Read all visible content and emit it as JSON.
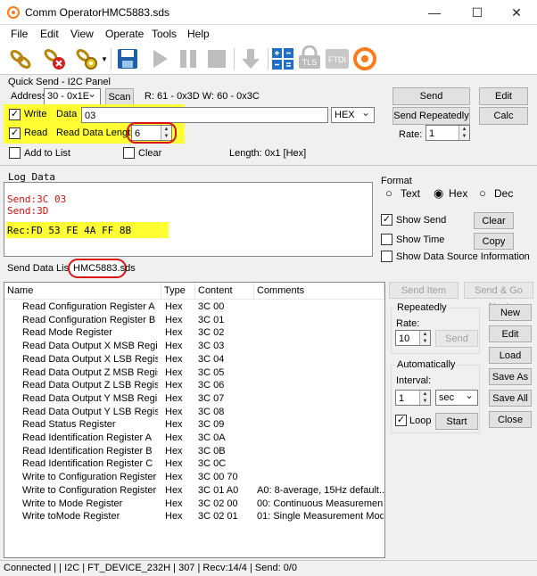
{
  "window": {
    "app_name": "Comm Operator",
    "file_name": "HMC5883.sds",
    "minimize": "—",
    "maximize": "☐",
    "close": "✕"
  },
  "menu": [
    "File",
    "Edit",
    "View",
    "Operate",
    "Tools",
    "Help"
  ],
  "toolbar": {
    "icons": [
      "connect-icon",
      "disconnect-icon",
      "settings-icon",
      "save-icon",
      "play-icon",
      "pause-icon",
      "stop-icon",
      "download-icon",
      "calculator-icon",
      "tls-icon",
      "ftdi-icon",
      "app-logo-icon"
    ],
    "tls": "TLS",
    "ftdi": "FTDI"
  },
  "quick_send": {
    "title": "Quick Send - I2C Panel",
    "address_label": "Address",
    "address_value": "30 - 0x1E",
    "scan": "Scan",
    "addr_info": "R: 61 - 0x3D  W: 60 - 0x3C",
    "write_label": "Write",
    "data_label": "Data",
    "data_value": "03",
    "format_value": "HEX",
    "read_label": "Read",
    "read_length_label": "Read Data Length",
    "read_length_value": "6",
    "add_to_list": "Add to List",
    "clear": "Clear",
    "length_info": "Length: 0x1 [Hex]",
    "send": "Send",
    "send_repeatedly": "Send Repeatedly",
    "rate_label": "Rate:",
    "rate_value": "1",
    "edit": "Edit",
    "calc": "Calc"
  },
  "log": {
    "title": "Log Data",
    "lines": [
      "Send:3C 03",
      "Send:3D"
    ],
    "rec": "Rec:FD 53 FE 4A FF 8B"
  },
  "format": {
    "title": "Format",
    "text": "Text",
    "hex": "Hex",
    "dec": "Dec",
    "selected": "Hex",
    "show_send": "Show Send",
    "show_time": "Show Time",
    "show_source": "Show Data Source Information",
    "clear": "Clear",
    "copy": "Copy"
  },
  "tabs": [
    "Send Data List",
    "HMC5883.sds"
  ],
  "table": {
    "headers": [
      "Name",
      "Type",
      "Content",
      "Comments"
    ],
    "rows": [
      [
        "Read Configuration Register A",
        "Hex",
        "3C 00",
        ""
      ],
      [
        "Read Configuration Register B",
        "Hex",
        "3C 01",
        ""
      ],
      [
        "Read Mode Register",
        "Hex",
        "3C 02",
        ""
      ],
      [
        "Read Data Output X MSB Register",
        "Hex",
        "3C 03",
        ""
      ],
      [
        "Read Data Output X LSB Register",
        "Hex",
        "3C 04",
        ""
      ],
      [
        "Read Data Output Z MSB Register",
        "Hex",
        "3C 05",
        ""
      ],
      [
        "Read Data Output Z LSB Register",
        "Hex",
        "3C 06",
        ""
      ],
      [
        "Read Data Output Y MSB Register",
        "Hex",
        "3C 07",
        ""
      ],
      [
        "Read Data Output Y LSB Register",
        "Hex",
        "3C 08",
        ""
      ],
      [
        "Read Status Register",
        "Hex",
        "3C 09",
        ""
      ],
      [
        "Read Identification Register A",
        "Hex",
        "3C 0A",
        ""
      ],
      [
        "Read Identification Register B",
        "Hex",
        "3C 0B",
        ""
      ],
      [
        "Read Identification Register C",
        "Hex",
        "3C 0C",
        ""
      ],
      [
        "Write to Configuration Register A",
        "Hex",
        "3C 00 70",
        ""
      ],
      [
        "Write to Configuration Register B",
        "Hex",
        "3C 01 A0",
        "A0: 8-average, 15Hz default..."
      ],
      [
        "Write to Mode Register",
        "Hex",
        "3C 02 00",
        "00: Continuous Measuremen..."
      ],
      [
        "Write toMode Register",
        "Hex",
        "3C 02 01",
        "01: Single Measurement Mode"
      ]
    ]
  },
  "right_panel": {
    "send_item": "Send Item",
    "send_go_next": "Send & Go Next",
    "repeatedly_title": "Repeatedly",
    "rate_label": "Rate:",
    "rate_value": "10",
    "send": "Send",
    "automatically_title": "Automatically",
    "interval_label": "Interval:",
    "interval_value": "1",
    "interval_unit": "sec",
    "loop": "Loop",
    "start": "Start",
    "new": "New",
    "edit": "Edit",
    "load": "Load",
    "save_as": "Save As",
    "save_all": "Save All",
    "close": "Close"
  },
  "status": "Connected |  | I2C | FT_DEVICE_232H | 307 | Recv:14/4 | Send: 0/0",
  "colors": {
    "highlight": "#ffff33",
    "log_send": "#d01010",
    "accent": "#ff7a1a"
  }
}
